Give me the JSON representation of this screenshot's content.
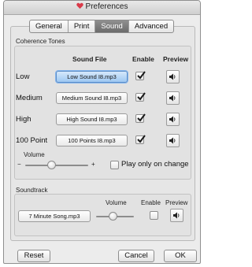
{
  "window": {
    "title": "Preferences"
  },
  "tabs": [
    {
      "label": "General"
    },
    {
      "label": "Print"
    },
    {
      "label": "Sound",
      "selected": true
    },
    {
      "label": "Advanced"
    }
  ],
  "coherence": {
    "group_title": "Coherence Tones",
    "col_sound_file": "Sound File",
    "col_enable": "Enable",
    "col_preview": "Preview",
    "rows": [
      {
        "label": "Low",
        "file": "Low Sound I8.mp3",
        "enabled": true
      },
      {
        "label": "Medium",
        "file": "Medium Sound I8.mp3",
        "enabled": true
      },
      {
        "label": "High",
        "file": "High Sound I8.mp3",
        "enabled": true
      },
      {
        "label": "100 Point",
        "file": "100 Points I8.mp3",
        "enabled": true
      }
    ],
    "volume_label": "Volume",
    "volume_minus": "−",
    "volume_plus": "+",
    "volume_level": 0.42,
    "play_only_label": "Play only on change",
    "play_only_checked": false
  },
  "soundtrack": {
    "group_title": "Soundtrack",
    "file": "7 Minute Song.mp3",
    "volume_label": "Volume",
    "enable_label": "Enable",
    "preview_label": "Preview",
    "volume_level": 0.45,
    "enabled": false
  },
  "buttons": {
    "reset": "Reset",
    "cancel": "Cancel",
    "ok": "OK"
  },
  "icons": {
    "title_icon": "heart-icon",
    "preview_icon": "speaker-icon"
  },
  "colors": {
    "selected_tab": "#7d7d7d",
    "focused_button": "#9ec8f2",
    "heart": "#d93a49"
  }
}
